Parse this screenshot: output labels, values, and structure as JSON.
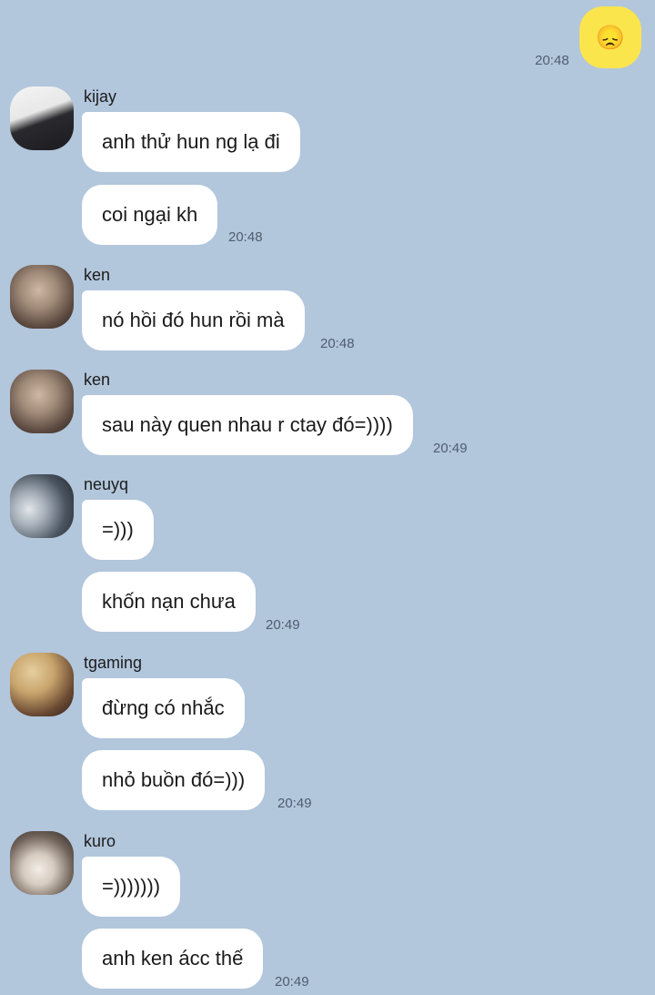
{
  "outgoing": {
    "emoji": "😞",
    "time": "20:48"
  },
  "groups": [
    {
      "user": "kijay",
      "messages": [
        "anh thử hun ng lạ đi",
        "coi ngại kh"
      ],
      "time": "20:48"
    },
    {
      "user": "ken",
      "messages": [
        "nó hồi đó hun rồi mà"
      ],
      "time": "20:48"
    },
    {
      "user": "ken",
      "messages": [
        "sau này quen nhau r ctay đó=))))"
      ],
      "time": "20:49"
    },
    {
      "user": "neuyq",
      "messages": [
        "=)))",
        "khốn nạn chưa"
      ],
      "time": "20:49"
    },
    {
      "user": "tgaming",
      "messages": [
        "đừng có nhắc",
        "nhỏ buồn đó=)))"
      ],
      "time": "20:49"
    },
    {
      "user": "kuro",
      "messages": [
        "=)))))))",
        "anh ken ácc thế"
      ],
      "time": "20:49"
    }
  ],
  "colors": {
    "background": "#b2c6dc",
    "bubble": "#ffffff",
    "my_bubble": "#fbe54d"
  }
}
